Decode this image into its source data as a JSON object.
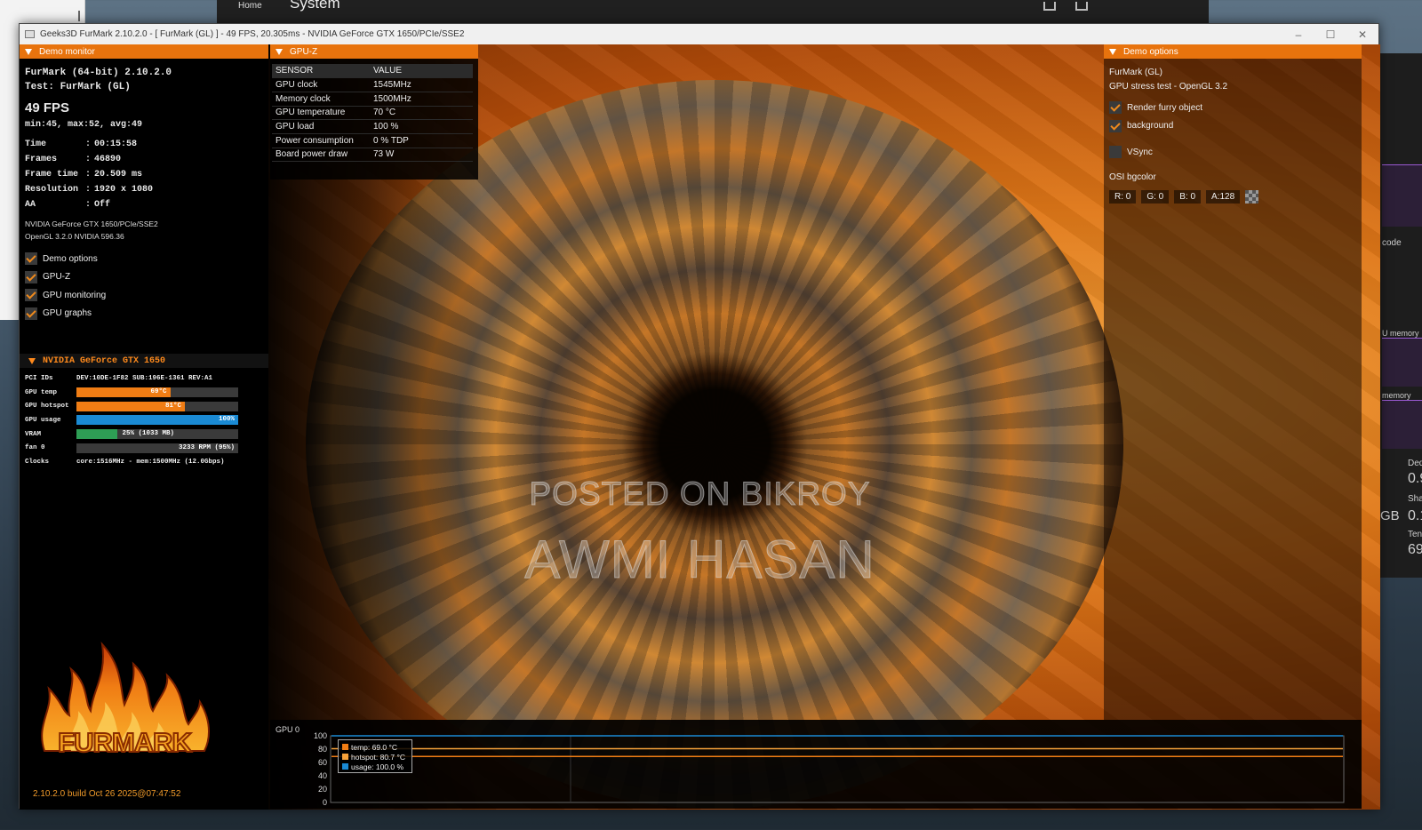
{
  "background": {
    "system_bar": {
      "home": "Home",
      "title": "System"
    },
    "right_panel": {
      "labels": [
        "code",
        "U memory",
        "memory",
        "Ded",
        "0.9",
        "Sha",
        "GB",
        "0.1",
        "Ten",
        "69"
      ]
    }
  },
  "window": {
    "title": "Geeks3D FurMark 2.10.2.0 - [ FurMark (GL) ] - 49 FPS, 20.305ms - NVIDIA GeForce GTX 1650/PCIe/SSE2",
    "minimize": "–",
    "maximize": "☐",
    "close": "✕"
  },
  "watermark": {
    "line1": "POSTED ON BIKROY",
    "line2": "AWMI HASAN"
  },
  "demo_monitor": {
    "header": "Demo monitor",
    "app_line": "FurMark (64-bit) 2.10.2.0",
    "test_line": "Test: FurMark (GL)",
    "fps": "49 FPS",
    "minmax": "min:45, max:52, avg:49",
    "stats": [
      {
        "k": "Time",
        "v": "00:15:58"
      },
      {
        "k": "Frames",
        "v": "46890"
      },
      {
        "k": "Frame time",
        "v": "20.509 ms"
      },
      {
        "k": "Resolution",
        "v": "1920 x 1080"
      },
      {
        "k": "AA",
        "v": "Off"
      }
    ],
    "gpu_line": "NVIDIA GeForce GTX 1650/PCIe/SSE2",
    "gl_line": "OpenGL 3.2.0 NVIDIA 596.36",
    "toggles": [
      {
        "label": "Demo options",
        "checked": true
      },
      {
        "label": "GPU-Z",
        "checked": true
      },
      {
        "label": "GPU monitoring",
        "checked": true
      },
      {
        "label": "GPU graphs",
        "checked": true
      }
    ],
    "gpu_section": {
      "title": "NVIDIA GeForce GTX 1650",
      "pci_label": "PCI IDs",
      "pci_value": "DEV:10DE-1F82 SUB:196E-1361 REV:A1",
      "bars": [
        {
          "label": "GPU temp",
          "text": "69°C",
          "fraction": 0.58,
          "color": "#f07d14"
        },
        {
          "label": "GPU hotspot",
          "text": "81°C",
          "fraction": 0.67,
          "color": "#f07d14"
        },
        {
          "label": "GPU usage",
          "text": "100%",
          "fraction": 1.0,
          "color": "#1a8ad4"
        },
        {
          "label": "VRAM",
          "text": "25% (1033 MB)",
          "fraction": 0.25,
          "color": "#2e9e55"
        },
        {
          "label": "fan 0",
          "text": "3233 RPM (95%)",
          "fraction": 0.0,
          "color": "#666666"
        }
      ],
      "clocks_label": "Clocks",
      "clocks_value": "core:1516MHz - mem:1500MHz (12.0Gbps)"
    },
    "logo_text": "FURMARK",
    "build": "2.10.2.0 build Oct 26 2025@07:47:52"
  },
  "gpuz": {
    "header": "GPU-Z",
    "columns": [
      "SENSOR",
      "VALUE"
    ],
    "rows": [
      [
        "GPU clock",
        "1545MHz"
      ],
      [
        "Memory clock",
        "1500MHz"
      ],
      [
        "GPU temperature",
        "70 °C"
      ],
      [
        "GPU load",
        "100 %"
      ],
      [
        "Power consumption",
        "0 % TDP"
      ],
      [
        "Board power draw",
        "73 W"
      ]
    ]
  },
  "demo_options": {
    "header": "Demo options",
    "line1": "FurMark (GL)",
    "line2": "GPU stress test - OpenGL 3.2",
    "toggles": [
      {
        "label": "Render furry object",
        "checked": true
      },
      {
        "label": "background",
        "checked": true
      },
      {
        "label": "VSync",
        "checked": false
      }
    ],
    "osi_label": "OSI bgcolor",
    "rgba": [
      "R: 0",
      "G: 0",
      "B: 0",
      "A:128"
    ]
  },
  "chart_data": {
    "type": "line",
    "title": "GPU 0",
    "ylim": [
      0,
      100
    ],
    "yticks": [
      100,
      80,
      60,
      40,
      20,
      0
    ],
    "series": [
      {
        "name": "temp: 69.0 °C",
        "value": 69.0,
        "color": "#f07d14"
      },
      {
        "name": "hotspot: 80.7 °C",
        "value": 80.7,
        "color": "#f6a23a"
      },
      {
        "name": "usage: 100.0 %",
        "value": 100.0,
        "color": "#1a8ad4"
      }
    ]
  }
}
